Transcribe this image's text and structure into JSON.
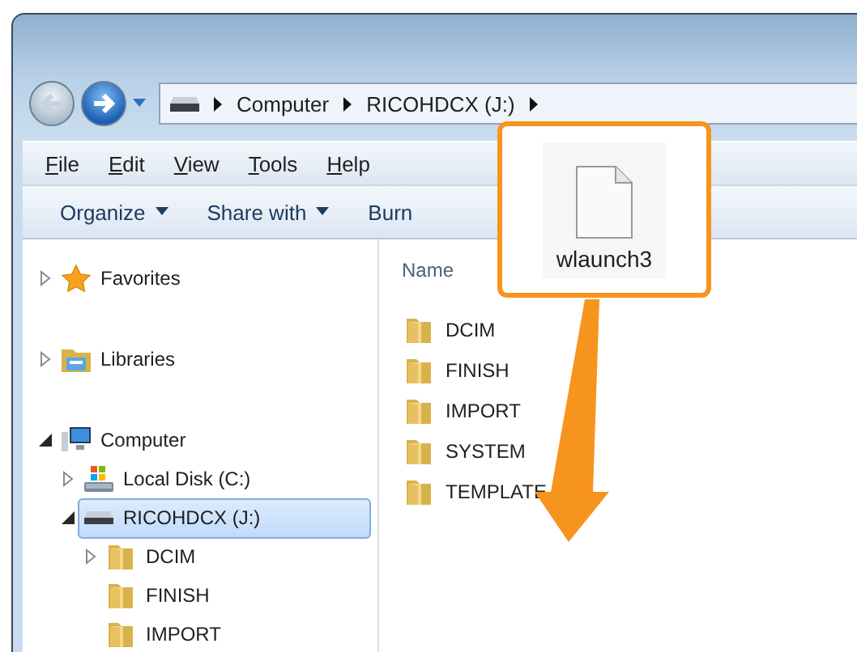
{
  "address_bar": {
    "segments": [
      "Computer",
      "RICOHDCX (J:)"
    ]
  },
  "menu": [
    "File",
    "Edit",
    "View",
    "Tools",
    "Help"
  ],
  "toolbar": [
    {
      "label": "Organize",
      "dropdown": true
    },
    {
      "label": "Share with",
      "dropdown": true
    },
    {
      "label": "Burn",
      "dropdown": false
    }
  ],
  "navigation": [
    {
      "label": "Favorites",
      "kind": "star",
      "expandable": true,
      "expanded": false,
      "selected": false
    },
    {
      "label": "Libraries",
      "kind": "library",
      "expandable": true,
      "expanded": false,
      "selected": false
    },
    {
      "label": "Computer",
      "kind": "computer",
      "expandable": true,
      "expanded": true,
      "selected": false,
      "children": [
        {
          "label": "Local Disk (C:)",
          "kind": "disk",
          "expandable": true,
          "expanded": false,
          "selected": false
        },
        {
          "label": "RICOHDCX (J:)",
          "kind": "drive",
          "expandable": true,
          "expanded": true,
          "selected": true,
          "children": [
            {
              "label": "DCIM",
              "kind": "folder",
              "expandable": true,
              "expanded": false,
              "selected": false
            },
            {
              "label": "FINISH",
              "kind": "folder",
              "expandable": false,
              "selected": false
            },
            {
              "label": "IMPORT",
              "kind": "folder",
              "expandable": false,
              "selected": false
            }
          ]
        }
      ]
    }
  ],
  "file_list": {
    "column": "Name",
    "items": [
      "DCIM",
      "FINISH",
      "IMPORT",
      "SYSTEM",
      "TEMPLATE"
    ]
  },
  "callout": {
    "file_name": "wlaunch3"
  }
}
